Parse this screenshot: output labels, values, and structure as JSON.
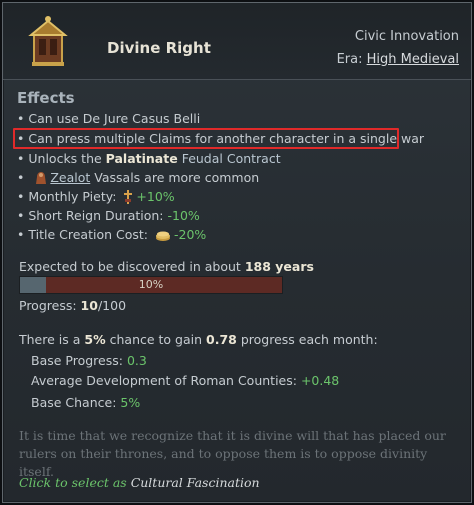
{
  "header": {
    "title": "Divine Right",
    "category": "Civic Innovation",
    "era_label": "Era:",
    "era_value": "High Medieval"
  },
  "effects": {
    "title": "Effects",
    "line1": "Can use De Jure Casus Belli",
    "line2": "Can press multiple Claims for another character in a single war",
    "line3_prefix": "Unlocks the",
    "line3_bold": "Palatinate",
    "line3_suffix": "Feudal Contract",
    "line4_link": "Zealot",
    "line4_suffix": "Vassals are more common",
    "line5_label": "Monthly Piety:",
    "line5_value": "+10%",
    "line6_label": "Short Reign Duration:",
    "line6_value": "-10%",
    "line7_label": "Title Creation Cost:",
    "line7_value": "-20%"
  },
  "discovery": {
    "expected_prefix": "Expected to be discovered in about",
    "expected_years": "188 years",
    "bar_text": "10%",
    "progress_fraction": 0.1,
    "progress_label": "Progress:",
    "progress_value": "10",
    "progress_total": "/100"
  },
  "chance": {
    "prefix": "There is a",
    "percent": "5%",
    "middle": "chance to gain",
    "amount": "0.78",
    "suffix": "progress each month:",
    "base_progress_label": "Base Progress:",
    "base_progress_value": "0.3",
    "avg_dev_label": "Average Development of Roman Counties:",
    "avg_dev_value": "+0.48",
    "base_chance_label": "Base Chance:",
    "base_chance_value": "5%"
  },
  "flavor": "It is time that we recognize that it is divine will that has placed our rulers on their thrones, and to oppose them is to oppose divinity itself.",
  "footer": {
    "hint": "Click to select as",
    "target": "Cultural Fascination"
  },
  "colors": {
    "positive": "#6bc46b",
    "highlight_border": "#e02a2a",
    "bar_fill": "#56666f",
    "bar_empty": "#5d2a24"
  },
  "icons": [
    "reliquary-icon",
    "zealot-icon",
    "piety-icon",
    "gold-icon"
  ]
}
